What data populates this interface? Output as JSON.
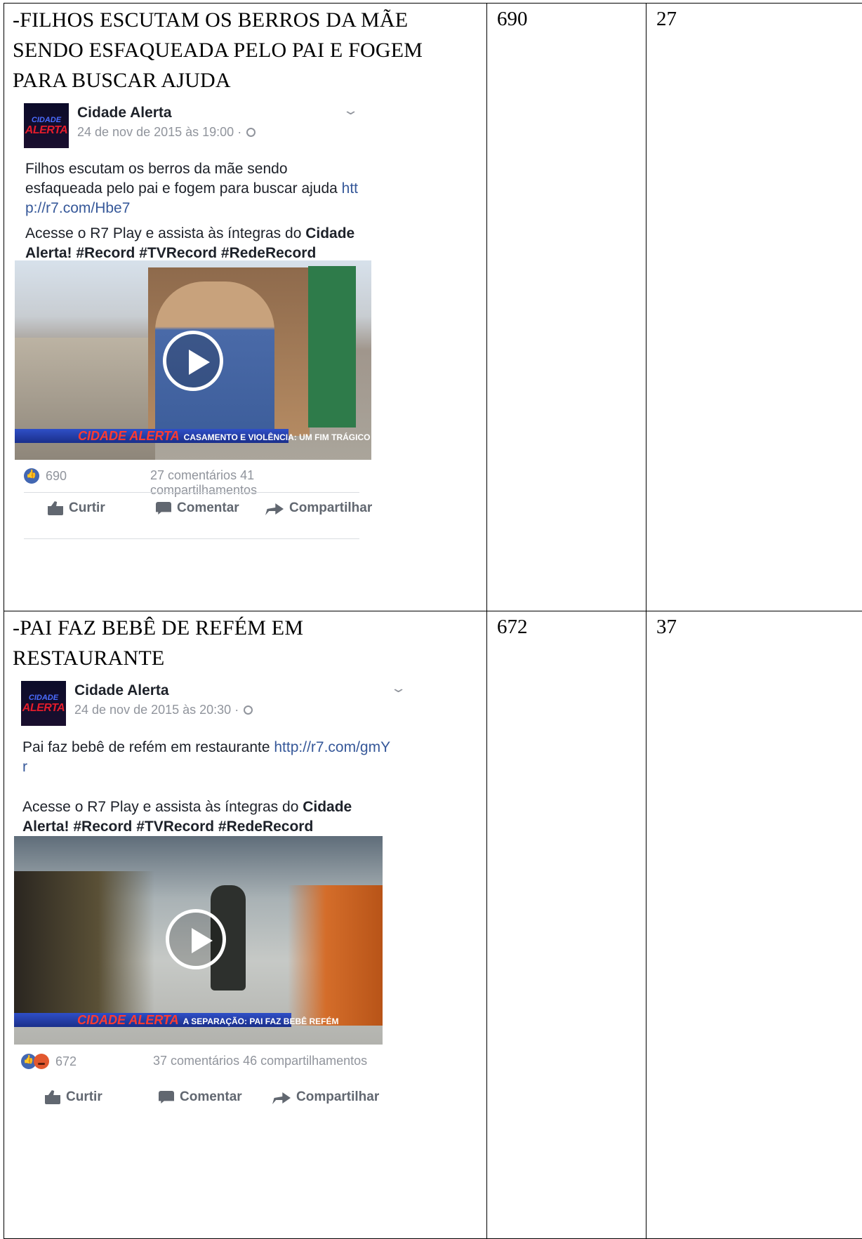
{
  "rows": [
    {
      "heading": "-FILHOS ESCUTAM OS BERROS DA MÃE SENDO ESFAQUEADA PELO PAI E FOGEM PARA BUSCAR AJUDA",
      "col2": "690",
      "col3": "27",
      "post": {
        "logo_top": "CIDADE",
        "logo_bottom": "ALERTA",
        "page_name": "Cidade Alerta",
        "timestamp": "24 de nov de 2015 às 19:00 ·",
        "text_plain": "Filhos escutam os berros da mãe sendo esfaqueada pelo pai e fogem para buscar ajuda ",
        "text_link": "http://r7.com/Hbe7",
        "cta_prefix": "Acesse o R7 Play e assista às íntegras do ",
        "cta_bold": "Cidade Alerta",
        "cta_tags": "! #Record #TVRecord #RedeRecord",
        "video_brand": "CIDADE ALERTA",
        "video_banner": "CASAMENTO E VIOLÊNCIA: UM FIM TRÁGICO",
        "reactions": "690",
        "comments": "27 comentários",
        "shares": "41 compartilhamentos",
        "btn_like": "Curtir",
        "btn_comment": "Comentar",
        "btn_share": "Compartilhar"
      }
    },
    {
      "heading": "-PAI FAZ BEBÊ DE REFÉM EM RESTAURANTE",
      "col2": "672",
      "col3": "37",
      "post": {
        "logo_top": "CIDADE",
        "logo_bottom": "ALERTA",
        "page_name": "Cidade Alerta",
        "timestamp": "24 de nov de 2015 às 20:30 ·",
        "text_plain": "Pai faz bebê de refém em restaurante ",
        "text_link": "http://r7.com/gmYr",
        "cta_prefix": "Acesse o R7 Play e assista às íntegras do ",
        "cta_bold": "Cidade Alerta",
        "cta_tags": "! #Record #TVRecord #RedeRecord",
        "video_brand": "CIDADE ALERTA",
        "video_banner": "A SEPARAÇÃO: PAI FAZ BEBÊ REFÉM",
        "reactions": "672",
        "comments": "37 comentários",
        "shares": "46 compartilhamentos",
        "btn_like": "Curtir",
        "btn_comment": "Comentar",
        "btn_share": "Compartilhar"
      }
    }
  ]
}
